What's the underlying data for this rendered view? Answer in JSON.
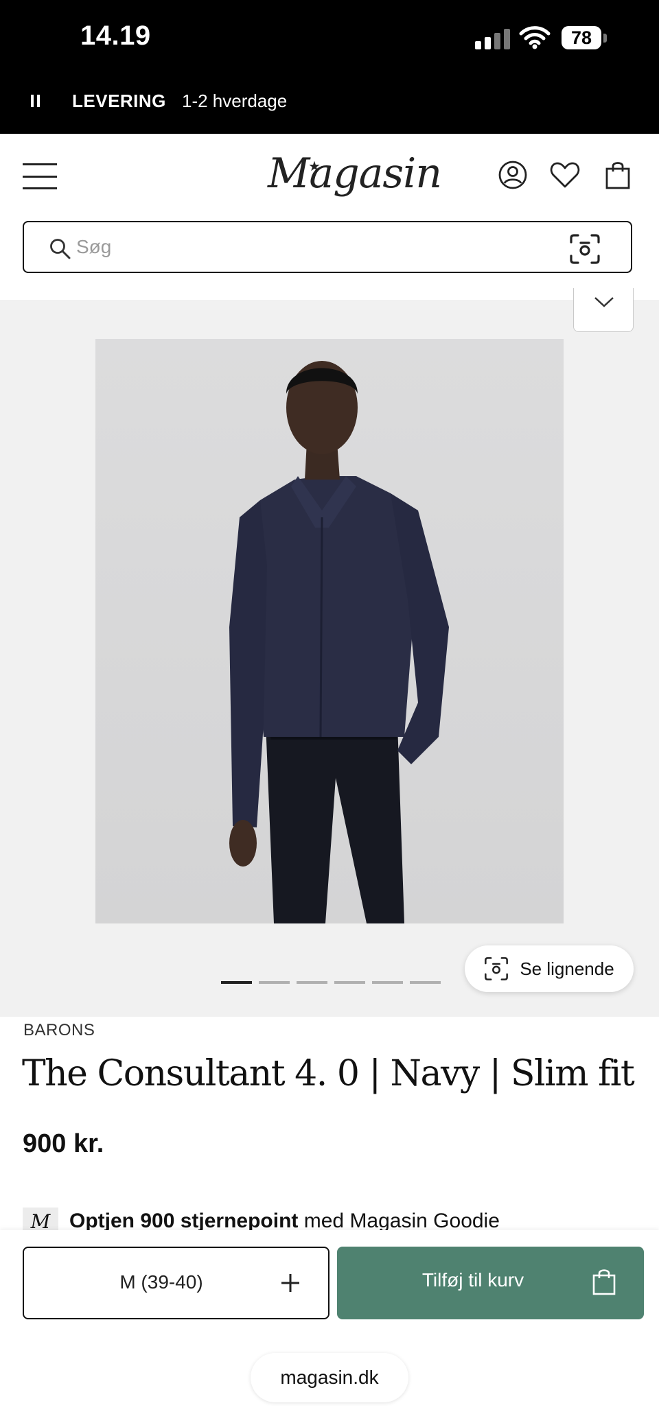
{
  "status_bar": {
    "time": "14.19",
    "battery": "78"
  },
  "announcement": {
    "label": "LEVERING",
    "text": "1-2 hverdage"
  },
  "header": {
    "logo_text": "Magasin"
  },
  "search": {
    "placeholder": "Søg"
  },
  "gallery": {
    "image_count": 6,
    "active_index": 0,
    "similar_label": "Se lignende"
  },
  "product": {
    "brand": "BARONS",
    "title": "The Consultant 4. 0 | Navy | Slim fit",
    "price": "900 kr.",
    "points_badge": "M",
    "points_bold": "Optjen 900 stjernepoint",
    "points_rest": "med Magasin Goodie"
  },
  "purchase": {
    "size_value": "M (39-40)",
    "add_to_cart": "Tilføj til kurv"
  },
  "browser": {
    "url": "magasin.dk"
  },
  "colors": {
    "accent_green": "#4f8270",
    "gallery_bg": "#f1f1f1",
    "status_bar": "#000000"
  }
}
